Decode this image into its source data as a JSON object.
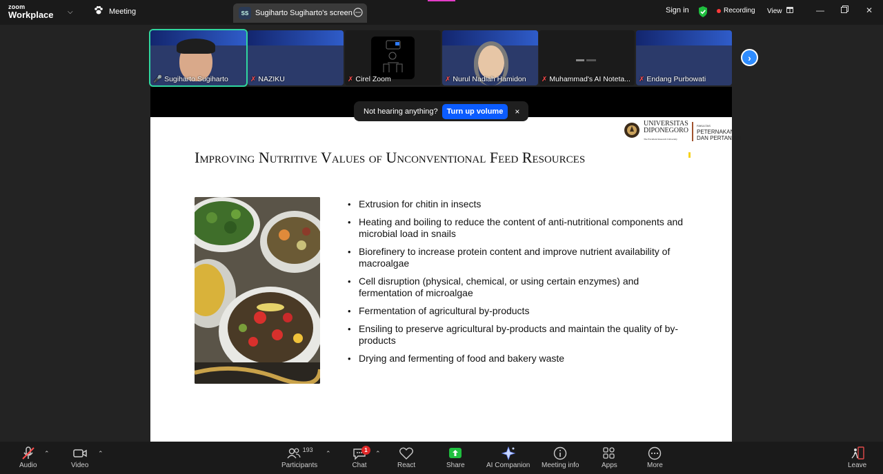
{
  "app": {
    "logo_top": "zoom",
    "logo_bottom": "Workplace"
  },
  "tabs": {
    "meeting": "Meeting",
    "screen_initials": "SS",
    "screen_title": "Sugiharto Sugiharto's screen"
  },
  "header": {
    "sign_in": "Sign in",
    "recording": "Recording",
    "view": "View"
  },
  "participants": [
    {
      "name": "Sugiharto Sugiharto",
      "muted": false,
      "active": true
    },
    {
      "name": "NAZIKU",
      "muted": true,
      "active": false
    },
    {
      "name": "Cirel Zoom",
      "muted": true,
      "active": false
    },
    {
      "name": "Nurul Nadiah Hamidon",
      "muted": true,
      "active": false
    },
    {
      "name": "Muhammad's AI Noteta...",
      "muted": true,
      "active": false
    },
    {
      "name": "Endang Purbowati",
      "muted": true,
      "active": false
    }
  ],
  "notice": {
    "text": "Not hearing anything?",
    "button": "Turn up volume",
    "close": "×"
  },
  "slide": {
    "university": "UNIVERSITAS\nDIPONEGORO",
    "university_tagline": "The Excellent Research University",
    "faculty_label": "FAKULTAS",
    "faculty": "PETERNAKAN\nDAN PERTANIAN",
    "title": "Improving Nutritive Values of Unconventional Feed Resources",
    "bullets": [
      "Extrusion for chitin in insects",
      "Heating and boiling to reduce the content of anti-nutritional components and microbial load in snails",
      "Biorefinery to increase protein content and improve nutrient availability of macroalgae",
      "Cell disruption (physical, chemical, or using certain enzymes) and fermentation of microalgae",
      "Fermentation of agricultural by-products",
      "Ensiling to preserve agricultural by-products and maintain the quality of by-products",
      "Drying and fermenting of food and bakery waste"
    ]
  },
  "toolbar": {
    "audio": "Audio",
    "video": "Video",
    "participants": "Participants",
    "participants_count": "193",
    "chat": "Chat",
    "chat_badge": "1",
    "react": "React",
    "share": "Share",
    "ai": "AI Companion",
    "info": "Meeting info",
    "apps": "Apps",
    "more": "More",
    "leave": "Leave"
  },
  "colors": {
    "accent": "#0b5cff",
    "active_border": "#30d7a0",
    "share_green": "#1fbf3f",
    "record_red": "#ff3b3b"
  }
}
